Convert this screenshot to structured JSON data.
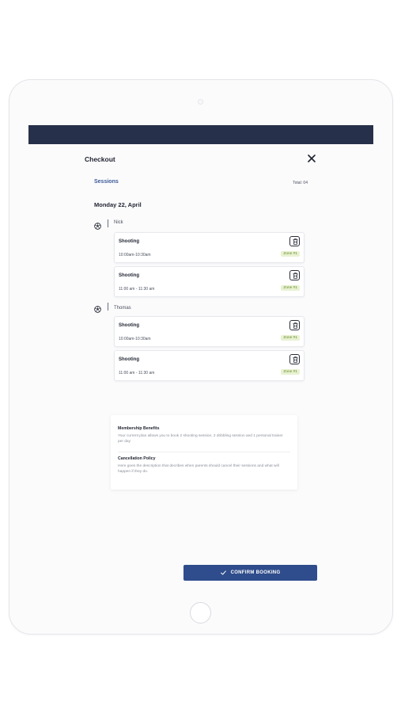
{
  "header": {
    "title": "Checkout",
    "close_icon": "close-icon"
  },
  "sessions": {
    "tab_label": "Sessions",
    "total": "Total: 04",
    "date": "Monday 22, April"
  },
  "players": [
    {
      "name": "Nick",
      "icon": "soccer-ball-icon",
      "bookings": [
        {
          "title": "Shooting",
          "time": "10:00am-10:30am",
          "zone": "Zone #1"
        },
        {
          "title": "Shooting",
          "time": "11:00 am - 11:30 am",
          "zone": "Zone #1"
        }
      ]
    },
    {
      "name": "Thomas",
      "icon": "soccer-ball-icon",
      "bookings": [
        {
          "title": "Shooting",
          "time": "10:00am-10:30am",
          "zone": "Zone #1"
        },
        {
          "title": "Shooting",
          "time": "11:00 am - 11:30 am",
          "zone": "Zone #1"
        }
      ]
    }
  ],
  "info": {
    "membership_title": "Membership Benefits",
    "membership_text": "Your current plan allows you to book 2 shooting session, 2 dribbling session and 1 personal trainer per day",
    "cancellation_title": "Cancellation Policy",
    "cancellation_text": "Here goes the description that decribes when parents should cancel their sessions and what will happen if they do."
  },
  "footer": {
    "confirm_label": "CONFIRM BOOKING",
    "confirm_icon": "check-icon"
  },
  "colors": {
    "topbar": "#27304a",
    "accent": "#3b5a98",
    "button": "#2f4d8c",
    "zone_bg": "#e8f2d2",
    "zone_text": "#6b8b2d"
  }
}
